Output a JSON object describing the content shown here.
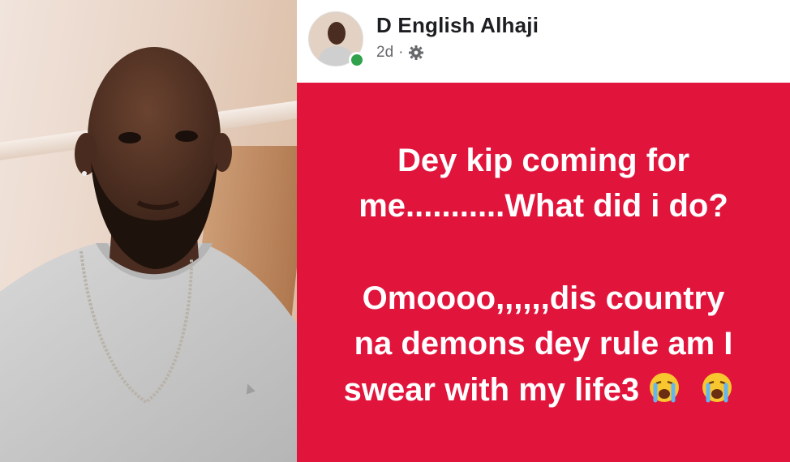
{
  "post": {
    "author_name": "D English Alhaji",
    "time_ago": "2d",
    "separator": "·",
    "privacy_icon": "gear-icon",
    "status_color": "#31a24c",
    "background_color": "#e1143c",
    "text_lines": [
      "Dey kip coming for",
      "me...........What did i do?",
      "Omoooo,,,,,,dis country",
      "na demons dey rule am I",
      "swear with my life3"
    ],
    "emoji_icons": [
      "loudly-crying-face-icon",
      "loudly-crying-face-icon"
    ]
  }
}
